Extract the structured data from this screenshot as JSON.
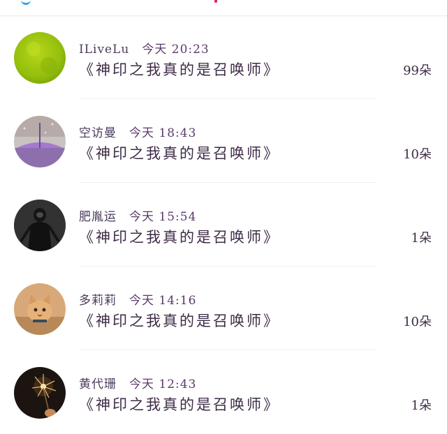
{
  "colors": {
    "accent_blue": "#33a3e6",
    "accent_pink": "#e0245e",
    "text_main": "#3e2b46"
  },
  "entries": [
    {
      "name": "ILiveLu",
      "time": "今天 20:23",
      "book": "《神印之我真的是召唤师》",
      "count": "99朵",
      "avatar": "green-blob"
    },
    {
      "name": "空访曼",
      "time": "今天 18:43",
      "book": "《神印之我真的是召唤师》",
      "count": "10朵",
      "avatar": "purple-umbrella"
    },
    {
      "name": "肥胤运",
      "time": "今天 15:54",
      "book": "《神印之我真的是召唤师》",
      "count": "1朵",
      "avatar": "dark-figure"
    },
    {
      "name": "多莉莉",
      "time": "今天 14:16",
      "book": "《神印之我真的是召唤师》",
      "count": "10朵",
      "avatar": "cat"
    },
    {
      "name": "黄代珊",
      "time": "今天 12:43",
      "book": "《神印之我真的是召唤师》",
      "count": "1朵",
      "avatar": "sparkler"
    }
  ]
}
